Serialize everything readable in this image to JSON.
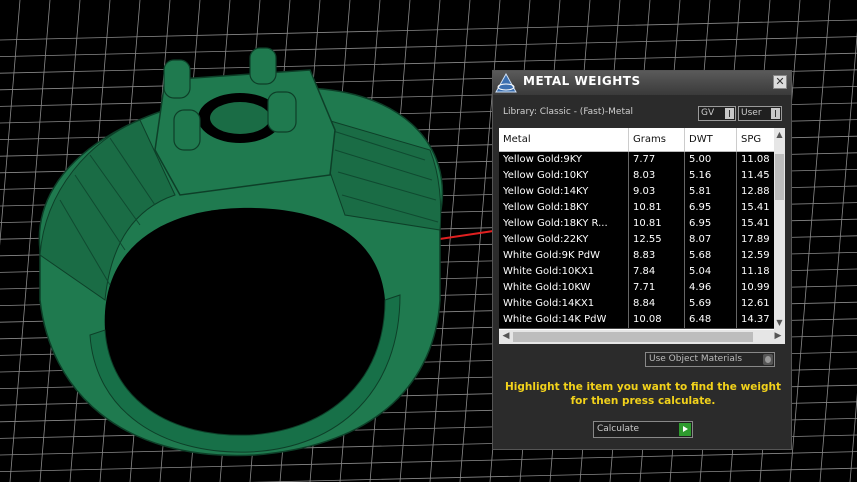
{
  "panel": {
    "title": "METAL WEIGHTS",
    "close_glyph": "✕",
    "library_label": "Library: Classic - (Fast)-Metal",
    "gv_label": "GV",
    "user_label": "User",
    "columns": [
      "Metal",
      "Grams",
      "DWT",
      "SPG"
    ],
    "rows": [
      [
        "Yellow Gold:9KY",
        "7.77",
        "5.00",
        "11.08"
      ],
      [
        "Yellow Gold:10KY",
        "8.03",
        "5.16",
        "11.45"
      ],
      [
        "Yellow Gold:14KY",
        "9.03",
        "5.81",
        "12.88"
      ],
      [
        "Yellow Gold:18KY",
        "10.81",
        "6.95",
        "15.41"
      ],
      [
        "Yellow Gold:18KY R...",
        "10.81",
        "6.95",
        "15.41"
      ],
      [
        "Yellow Gold:22KY",
        "12.55",
        "8.07",
        "17.89"
      ],
      [
        "White Gold:9K PdW",
        "8.83",
        "5.68",
        "12.59"
      ],
      [
        "White Gold:10KX1",
        "7.84",
        "5.04",
        "11.18"
      ],
      [
        "White Gold:10KW",
        "7.71",
        "4.96",
        "10.99"
      ],
      [
        "White Gold:14KX1",
        "8.84",
        "5.69",
        "12.61"
      ],
      [
        "White Gold:14K PdW",
        "10.08",
        "6.48",
        "14.37"
      ]
    ],
    "use_object_materials": "Use Object Materials",
    "hint": "Highlight the item you want to find the weight for then press calculate.",
    "calculate_label": "Calculate"
  },
  "icons": {
    "logo": "cad-logo-icon",
    "close": "close-icon",
    "calculate": "play-arrow-icon"
  },
  "colors": {
    "ring": "#1f7a4f",
    "grid": "#8a8a8a",
    "axis_x": "#e02020",
    "axis_y": "#2fa6d8",
    "hint": "#f2d21b"
  }
}
